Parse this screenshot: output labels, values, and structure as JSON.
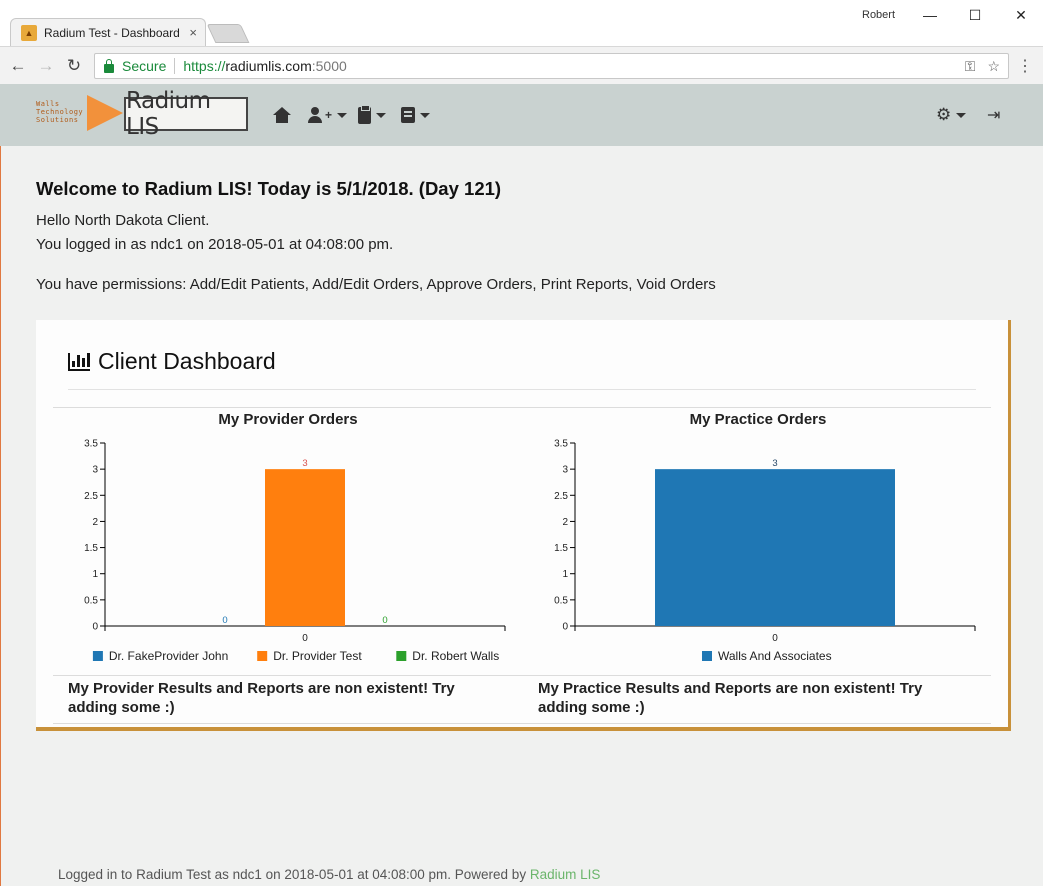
{
  "browser": {
    "tab_title": "Radium Test - Dashboard",
    "profile_name": "Robert",
    "secure_label": "Secure",
    "url_scheme": "https://",
    "url_host": "radiumlis.com",
    "url_port": ":5000"
  },
  "navbar": {
    "brand_small": [
      "Walls",
      "Technology",
      "Solutions"
    ],
    "brand_name": "Radium LIS",
    "icons": [
      "home-icon",
      "add-user-icon",
      "clipboard-icon",
      "book-icon",
      "gears-icon",
      "sign-out-icon"
    ]
  },
  "page": {
    "welcome": "Welcome to Radium LIS! Today is 5/1/2018. (Day 121)",
    "hello": "Hello North Dakota Client.",
    "logged_in": "You logged in as ndc1 on 2018-05-01 at 04:08:00 pm.",
    "permissions": "You have permissions: Add/Edit Patients, Add/Edit Orders, Approve Orders, Print Reports, Void Orders"
  },
  "dashboard": {
    "title": "Client Dashboard",
    "provider_results": "My Provider Results and Reports are non existent! Try adding some :)",
    "practice_results": "My Practice Results and Reports are non existent! Try adding some :)"
  },
  "chart_data": [
    {
      "type": "bar",
      "title": "My Provider Orders",
      "categories": [
        "0"
      ],
      "series": [
        {
          "name": "Dr. FakeProvider John",
          "values": [
            0
          ],
          "color": "#1f77b4"
        },
        {
          "name": "Dr. Provider Test",
          "values": [
            3
          ],
          "color": "#ff7f0e"
        },
        {
          "name": "Dr. Robert Walls",
          "values": [
            0
          ],
          "color": "#2ca02c"
        }
      ],
      "ylim": [
        0,
        3.5
      ],
      "yticks": [
        "0",
        "0.5",
        "1",
        "1.5",
        "2",
        "2.5",
        "3",
        "3.5"
      ],
      "legend": "bottom"
    },
    {
      "type": "bar",
      "title": "My Practice Orders",
      "categories": [
        "0"
      ],
      "series": [
        {
          "name": "Walls And Associates",
          "values": [
            3
          ],
          "color": "#1f77b4"
        }
      ],
      "ylim": [
        0,
        3.5
      ],
      "yticks": [
        "0",
        "0.5",
        "1",
        "1.5",
        "2",
        "2.5",
        "3",
        "3.5"
      ],
      "legend": "bottom"
    }
  ],
  "footer": {
    "text": "Logged in to Radium Test as ndc1 on 2018-05-01 at 04:08:00 pm. Powered by ",
    "link": "Radium LIS"
  },
  "colors": {
    "navbar_bg": "#c9d2d0",
    "panel_accent": "#c8913a",
    "secure_green": "#1a8a3b",
    "footer_link": "#6bb56b"
  }
}
